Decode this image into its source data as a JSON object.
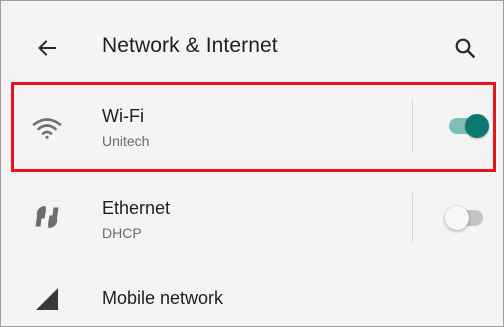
{
  "header": {
    "title": "Network & Internet",
    "back_icon": "arrow-left-icon",
    "search_icon": "search-icon"
  },
  "items": [
    {
      "title": "Wi-Fi",
      "subtitle": "Unitech",
      "icon": "wifi-icon",
      "toggle": "on"
    },
    {
      "title": "Ethernet",
      "subtitle": "DHCP",
      "icon": "ethernet-icon",
      "toggle": "off"
    },
    {
      "title": "Mobile network",
      "icon": "signal-icon"
    }
  ],
  "colors": {
    "accent": "#0a7a6e",
    "highlight": "#e8141c"
  }
}
